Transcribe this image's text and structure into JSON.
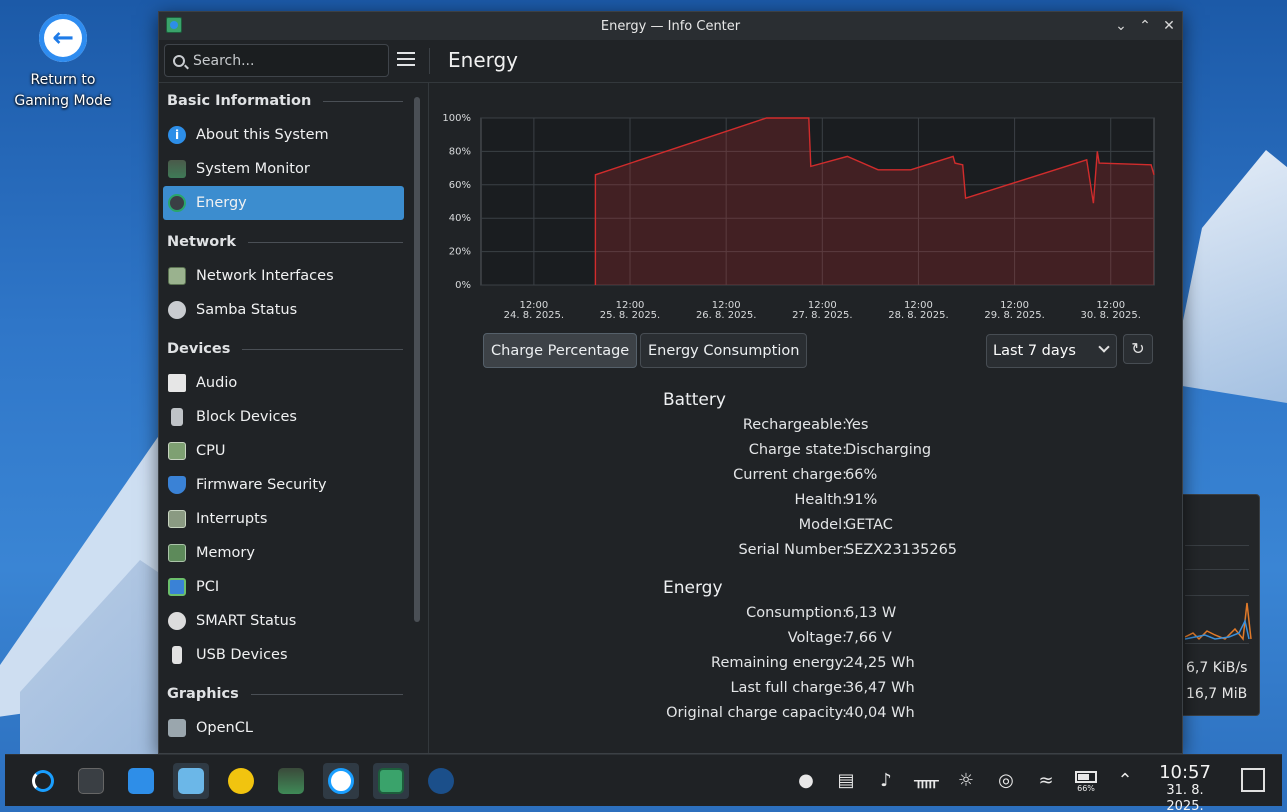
{
  "desktop": {
    "icon_label": "Return to Gaming Mode",
    "widget_net_rate": "6,7 KiB/s",
    "widget_mem": "16,7 MiB"
  },
  "window": {
    "title": "Energy — Info Center",
    "search_placeholder": "Search...",
    "page_title": "Energy"
  },
  "sidebar": {
    "sections": [
      {
        "title": "Basic Information",
        "items": [
          {
            "label": "About this System",
            "icon": "info-icon"
          },
          {
            "label": "System Monitor",
            "icon": "system-monitor-icon"
          },
          {
            "label": "Energy",
            "icon": "energy-icon",
            "active": true
          }
        ]
      },
      {
        "title": "Network",
        "items": [
          {
            "label": "Network Interfaces",
            "icon": "network-card-icon"
          },
          {
            "label": "Samba Status",
            "icon": "samba-icon"
          }
        ]
      },
      {
        "title": "Devices",
        "items": [
          {
            "label": "Audio",
            "icon": "audio-card-icon"
          },
          {
            "label": "Block Devices",
            "icon": "drive-icon"
          },
          {
            "label": "CPU",
            "icon": "cpu-icon"
          },
          {
            "label": "Firmware Security",
            "icon": "shield-icon"
          },
          {
            "label": "Interrupts",
            "icon": "interrupts-icon"
          },
          {
            "label": "Memory",
            "icon": "memory-icon"
          },
          {
            "label": "PCI",
            "icon": "pci-icon"
          },
          {
            "label": "SMART Status",
            "icon": "smart-disk-icon"
          },
          {
            "label": "USB Devices",
            "icon": "usb-icon"
          }
        ]
      },
      {
        "title": "Graphics",
        "items": [
          {
            "label": "OpenCL",
            "icon": "opencl-icon"
          }
        ]
      }
    ]
  },
  "controls": {
    "charge_percentage": "Charge Percentage",
    "energy_consumption": "Energy Consumption",
    "range_selected": "Last 7 days"
  },
  "chart_data": {
    "type": "area",
    "y_ticks": [
      "100%",
      "80%",
      "60%",
      "40%",
      "20%",
      "0%"
    ],
    "ylim": [
      0,
      100
    ],
    "x_tick_times": [
      "12:00",
      "12:00",
      "12:00",
      "12:00",
      "12:00",
      "12:00",
      "12:00"
    ],
    "x_tick_dates": [
      "24. 8. 2025.",
      "25. 8. 2025.",
      "26. 8. 2025.",
      "27. 8. 2025.",
      "28. 8. 2025.",
      "29. 8. 2025.",
      "30. 8. 2025."
    ],
    "x_range_days": [
      23.95,
      30.95
    ],
    "series_color": "#d12c2c",
    "points": [
      [
        25.14,
        0
      ],
      [
        25.14,
        66
      ],
      [
        26.92,
        100
      ],
      [
        27.36,
        100
      ],
      [
        27.38,
        71
      ],
      [
        27.76,
        77
      ],
      [
        28.08,
        69
      ],
      [
        28.42,
        69
      ],
      [
        28.86,
        77
      ],
      [
        28.88,
        73
      ],
      [
        28.96,
        72
      ],
      [
        28.99,
        52
      ],
      [
        30.25,
        75
      ],
      [
        30.32,
        49
      ],
      [
        30.36,
        80
      ],
      [
        30.38,
        73
      ],
      [
        30.92,
        72
      ],
      [
        30.95,
        66
      ]
    ]
  },
  "battery": {
    "title": "Battery",
    "rows": [
      {
        "k": "Rechargeable:",
        "v": "Yes"
      },
      {
        "k": "Charge state:",
        "v": "Discharging"
      },
      {
        "k": "Current charge:",
        "v": "66%"
      },
      {
        "k": "Health:",
        "v": "91%"
      },
      {
        "k": "Model:",
        "v": "GETAC"
      },
      {
        "k": "Serial Number:",
        "v": "SEZX23135265"
      }
    ]
  },
  "energy": {
    "title": "Energy",
    "rows": [
      {
        "k": "Consumption:",
        "v": "6,13 W"
      },
      {
        "k": "Voltage:",
        "v": "7,66 V"
      },
      {
        "k": "Remaining energy:",
        "v": "24,25 Wh"
      },
      {
        "k": "Last full charge:",
        "v": "36,47 Wh"
      },
      {
        "k": "Original charge capacity:",
        "v": "40,04 Wh"
      }
    ]
  },
  "taskbar": {
    "battery_percent": "66%",
    "time": "10:57",
    "date": "31. 8. 2025."
  }
}
